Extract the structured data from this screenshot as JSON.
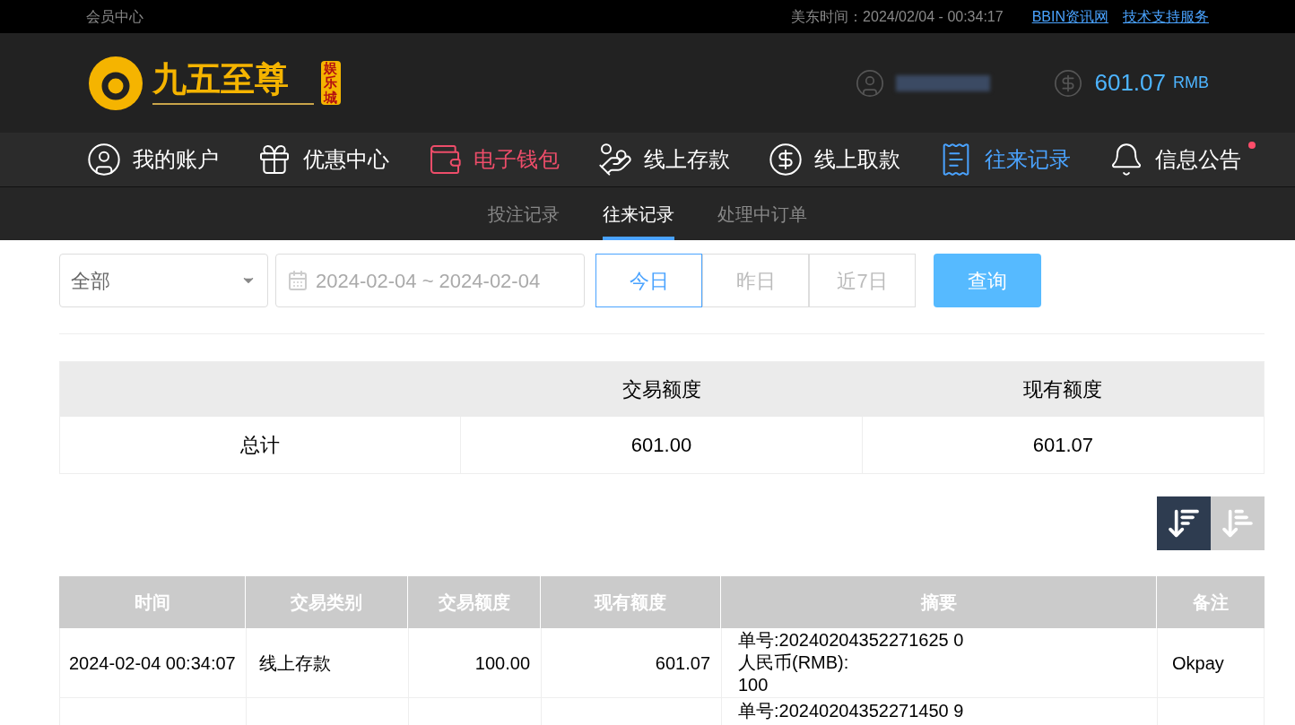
{
  "top_bar": {
    "title": "会员中心",
    "time": "美东时间：2024/02/04 - 00:34:17",
    "links": [
      "BBIN资讯网",
      "技术支持服务"
    ]
  },
  "header": {
    "logo": {
      "name": "九五至尊",
      "tag": "娱乐城"
    },
    "balance": "601.07",
    "currency": "RMB"
  },
  "nav": [
    {
      "label": "我的账户",
      "selected": false,
      "kind": "normal",
      "badge": false
    },
    {
      "label": "优惠中心",
      "selected": false,
      "kind": "normal",
      "badge": false
    },
    {
      "label": "电子钱包",
      "selected": false,
      "kind": "highlight",
      "badge": false
    },
    {
      "label": "线上存款",
      "selected": false,
      "kind": "normal",
      "badge": false
    },
    {
      "label": "线上取款",
      "selected": false,
      "kind": "normal",
      "badge": false
    },
    {
      "label": "往来记录",
      "selected": true,
      "kind": "normal",
      "badge": false
    },
    {
      "label": "信息公告",
      "selected": false,
      "kind": "normal",
      "badge": true
    }
  ],
  "sub_tabs": [
    {
      "label": "投注记录",
      "selected": false
    },
    {
      "label": "往来记录",
      "selected": true
    },
    {
      "label": "处理中订单",
      "selected": false
    }
  ],
  "filter": {
    "type_select": "全部",
    "date_range": "2024-02-04 ~ 2024-02-04",
    "quick_ranges": [
      {
        "label": "今日",
        "selected": true
      },
      {
        "label": "昨日",
        "selected": false
      },
      {
        "label": "近7日",
        "selected": false
      }
    ],
    "query_button": "查询"
  },
  "summary": {
    "columns": [
      "交易额度",
      "现有额度"
    ],
    "row": {
      "label": "总计",
      "values": [
        "601.00",
        "601.07"
      ]
    }
  },
  "sort_buttons": [
    {
      "selected": true
    },
    {
      "selected": false
    }
  ],
  "table": {
    "columns": [
      "时间",
      "交易类别",
      "交易额度",
      "现有额度",
      "摘要",
      "备注"
    ],
    "rows": [
      {
        "time": "2024-02-04 00:34:07",
        "type": "线上存款",
        "amount": "100.00",
        "balance": "601.07",
        "summary": [
          "单号:20240204352271625 0",
          "人民币(RMB):",
          "100"
        ],
        "note": "Okpay"
      },
      {
        "time": "",
        "type": "",
        "amount": "",
        "balance": "",
        "summary": [
          "单号:20240204352271450 9"
        ],
        "note": ""
      }
    ]
  }
}
